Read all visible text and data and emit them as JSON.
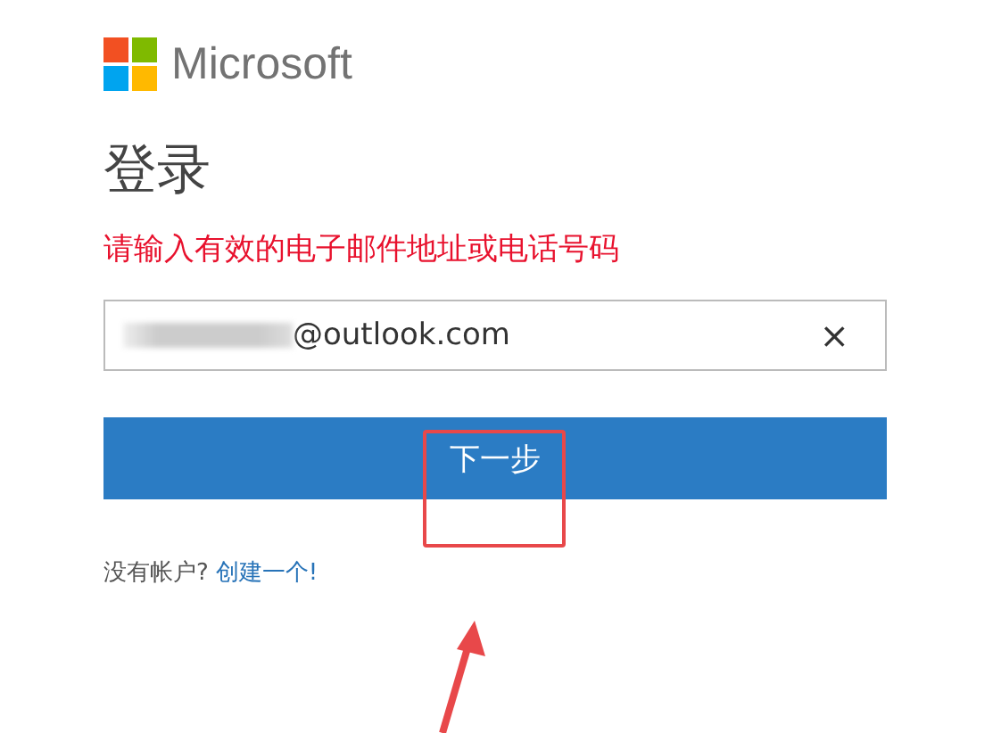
{
  "brand": {
    "name": "Microsoft"
  },
  "title": "登录",
  "error": "请输入有效的电子邮件地址或电话号码",
  "email_field": {
    "value": "@outlook.com",
    "redacted": true,
    "clear": "×"
  },
  "next_button": {
    "label": "下一步"
  },
  "footer": {
    "text": "没有帐户?",
    "link": "创建一个!"
  }
}
